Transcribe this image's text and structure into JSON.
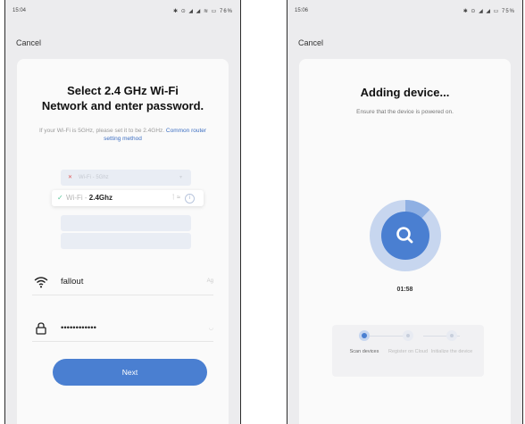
{
  "left_screen": {
    "status": {
      "time": "15:04",
      "icons": "✱ ⊙ ◢ ◢ ≋ ▭ 76%"
    },
    "cancel_label": "Cancel",
    "title_line1": "Select 2.4 GHz Wi-Fi",
    "title_line2": "Network and enter password.",
    "subtitle_text": "If your Wi-Fi is 5GHz, please set it to be 2.4GHz.",
    "subtitle_link": "Common router setting method",
    "illustration": {
      "row_5g_label": "Wi-Fi - 5Ghz",
      "row_24_prefix": "Wi-Fi - ",
      "row_24_band": "2.4Ghz"
    },
    "wifi_field": {
      "value": "fallout",
      "right_label": "Ag"
    },
    "password_field": {
      "value": "••••••••••••"
    },
    "next_label": "Next"
  },
  "right_screen": {
    "status": {
      "time": "15:06",
      "icons": "✱ ⊙ ◢ ◢ ▭ 75%"
    },
    "cancel_label": "Cancel",
    "title": "Adding device...",
    "subtitle": "Ensure that the device is powered on.",
    "timer": "01:58",
    "progress_fraction": 0.12,
    "steps": [
      {
        "label": "Scan devices",
        "active": true
      },
      {
        "label": "Register on Cloud",
        "active": false
      },
      {
        "label": "Initialize the device",
        "active": false
      }
    ]
  },
  "colors": {
    "accent": "#4a7fd1",
    "ring_light": "#c7d6ef",
    "ring_mid": "#8fb0e3",
    "check": "#58c79a",
    "cross": "#e05a5a"
  }
}
